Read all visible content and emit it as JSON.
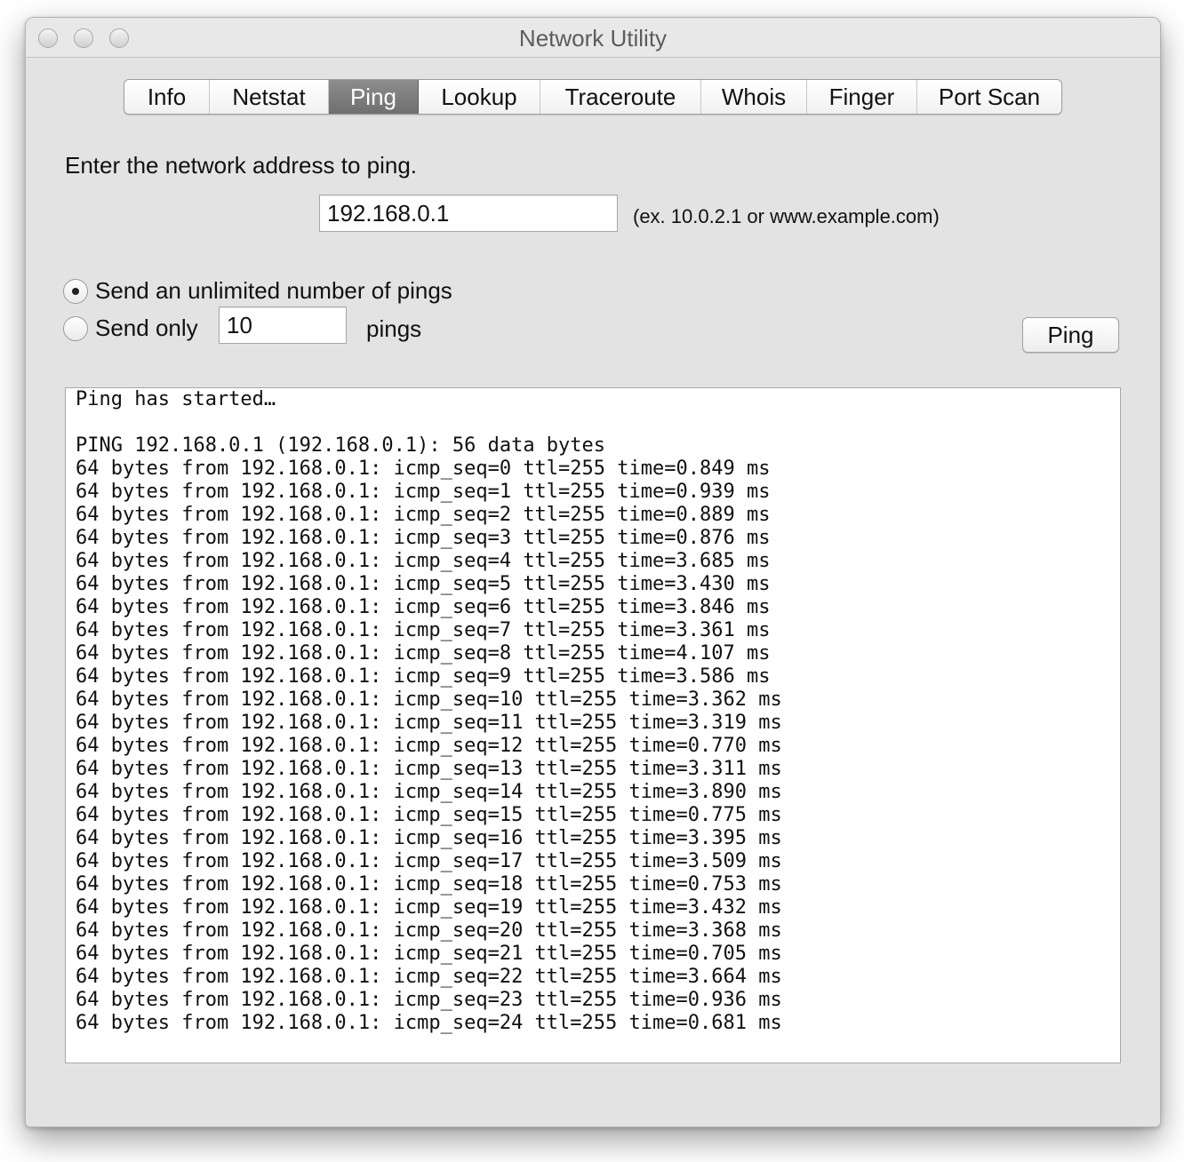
{
  "window": {
    "title": "Network Utility"
  },
  "tabs": [
    {
      "label": "Info",
      "active": false
    },
    {
      "label": "Netstat",
      "active": false
    },
    {
      "label": "Ping",
      "active": true
    },
    {
      "label": "Lookup",
      "active": false
    },
    {
      "label": "Traceroute",
      "active": false
    },
    {
      "label": "Whois",
      "active": false
    },
    {
      "label": "Finger",
      "active": false
    },
    {
      "label": "Port Scan",
      "active": false
    }
  ],
  "ping": {
    "prompt": "Enter the network address to ping.",
    "address_value": "192.168.0.1",
    "address_hint": "(ex. 10.0.2.1 or www.example.com)",
    "option_unlimited_label": "Send an unlimited number of pings",
    "option_unlimited_selected": true,
    "option_count_label": "Send only",
    "option_count_selected": false,
    "count_value": "10",
    "count_suffix": "pings",
    "button_label": "Ping"
  },
  "output": {
    "lines": [
      "Ping has started…",
      "",
      "PING 192.168.0.1 (192.168.0.1): 56 data bytes",
      "64 bytes from 192.168.0.1: icmp_seq=0 ttl=255 time=0.849 ms",
      "64 bytes from 192.168.0.1: icmp_seq=1 ttl=255 time=0.939 ms",
      "64 bytes from 192.168.0.1: icmp_seq=2 ttl=255 time=0.889 ms",
      "64 bytes from 192.168.0.1: icmp_seq=3 ttl=255 time=0.876 ms",
      "64 bytes from 192.168.0.1: icmp_seq=4 ttl=255 time=3.685 ms",
      "64 bytes from 192.168.0.1: icmp_seq=5 ttl=255 time=3.430 ms",
      "64 bytes from 192.168.0.1: icmp_seq=6 ttl=255 time=3.846 ms",
      "64 bytes from 192.168.0.1: icmp_seq=7 ttl=255 time=3.361 ms",
      "64 bytes from 192.168.0.1: icmp_seq=8 ttl=255 time=4.107 ms",
      "64 bytes from 192.168.0.1: icmp_seq=9 ttl=255 time=3.586 ms",
      "64 bytes from 192.168.0.1: icmp_seq=10 ttl=255 time=3.362 ms",
      "64 bytes from 192.168.0.1: icmp_seq=11 ttl=255 time=3.319 ms",
      "64 bytes from 192.168.0.1: icmp_seq=12 ttl=255 time=0.770 ms",
      "64 bytes from 192.168.0.1: icmp_seq=13 ttl=255 time=3.311 ms",
      "64 bytes from 192.168.0.1: icmp_seq=14 ttl=255 time=3.890 ms",
      "64 bytes from 192.168.0.1: icmp_seq=15 ttl=255 time=0.775 ms",
      "64 bytes from 192.168.0.1: icmp_seq=16 ttl=255 time=3.395 ms",
      "64 bytes from 192.168.0.1: icmp_seq=17 ttl=255 time=3.509 ms",
      "64 bytes from 192.168.0.1: icmp_seq=18 ttl=255 time=0.753 ms",
      "64 bytes from 192.168.0.1: icmp_seq=19 ttl=255 time=3.432 ms",
      "64 bytes from 192.168.0.1: icmp_seq=20 ttl=255 time=3.368 ms",
      "64 bytes from 192.168.0.1: icmp_seq=21 ttl=255 time=0.705 ms",
      "64 bytes from 192.168.0.1: icmp_seq=22 ttl=255 time=3.664 ms",
      "64 bytes from 192.168.0.1: icmp_seq=23 ttl=255 time=0.936 ms",
      "64 bytes from 192.168.0.1: icmp_seq=24 ttl=255 time=0.681 ms"
    ]
  }
}
